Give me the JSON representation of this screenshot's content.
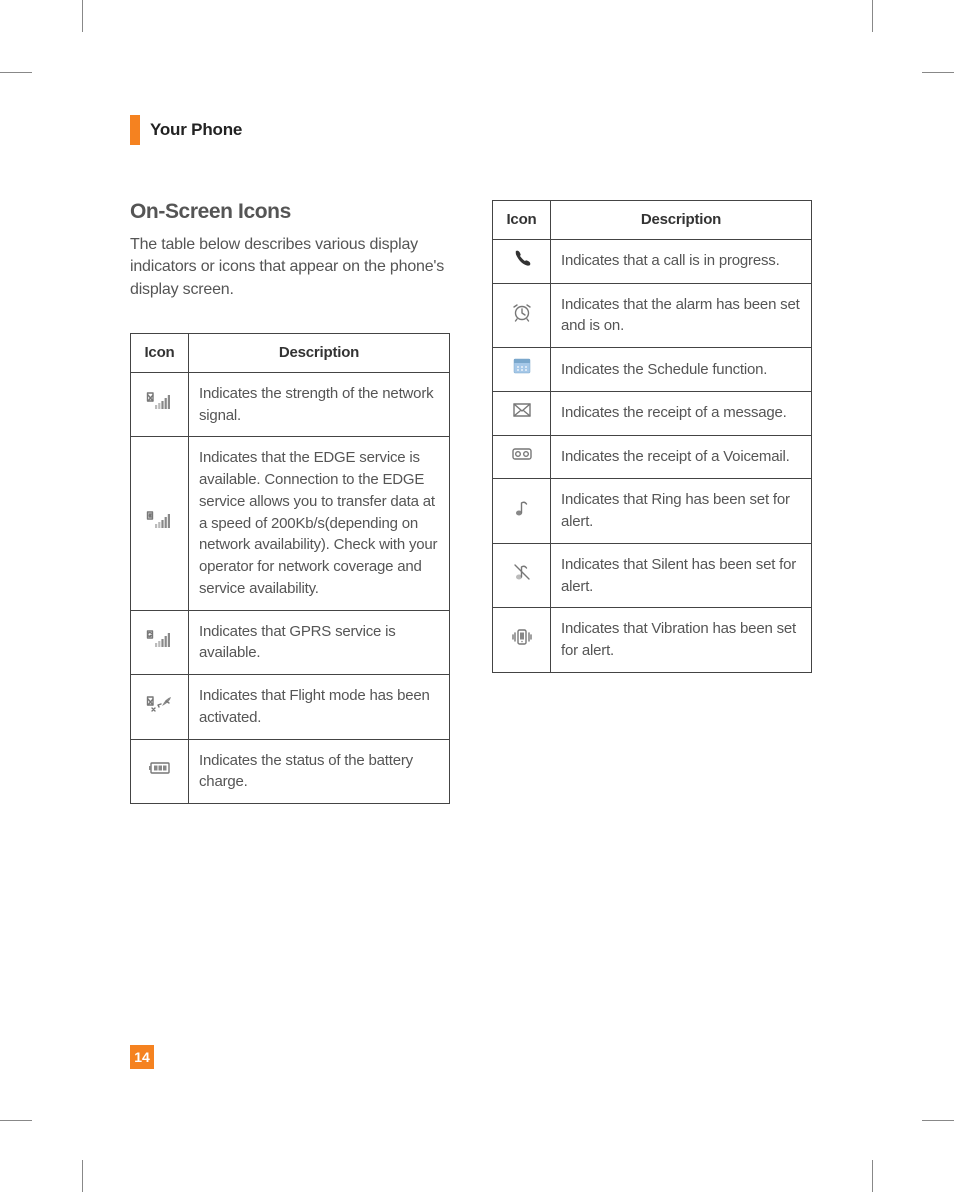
{
  "header": {
    "title": "Your Phone"
  },
  "section": {
    "title": "On-Screen Icons",
    "intro": "The table below describes various display indicators or icons that appear on the phone's display screen."
  },
  "table_headers": {
    "icon": "Icon",
    "description": "Description"
  },
  "table1": [
    {
      "icon": "signal",
      "desc": "Indicates the strength of the network signal."
    },
    {
      "icon": "edge",
      "desc": "Indicates that the EDGE service is available. Connection to the EDGE service allows you to transfer data at a speed of 200Kb/s(depending on network availability). Check with your operator for network coverage and service availability."
    },
    {
      "icon": "gprs",
      "desc": "Indicates that GPRS service is available."
    },
    {
      "icon": "flight",
      "desc": "Indicates that Flight mode has been activated."
    },
    {
      "icon": "battery",
      "desc": "Indicates the status of the battery charge."
    }
  ],
  "table2": [
    {
      "icon": "call",
      "desc": "Indicates that a call is in progress."
    },
    {
      "icon": "alarm",
      "desc": "Indicates that the alarm has been set and is on."
    },
    {
      "icon": "schedule",
      "desc": "Indicates the Schedule function."
    },
    {
      "icon": "message",
      "desc": "Indicates the receipt of a message."
    },
    {
      "icon": "voicemail",
      "desc": "Indicates the receipt of a Voicemail."
    },
    {
      "icon": "ring",
      "desc": "Indicates that Ring has been set for alert."
    },
    {
      "icon": "silent",
      "desc": "Indicates that Silent has been set for alert."
    },
    {
      "icon": "vibration",
      "desc": "Indicates that Vibration has been set for alert."
    }
  ],
  "page_number": "14"
}
